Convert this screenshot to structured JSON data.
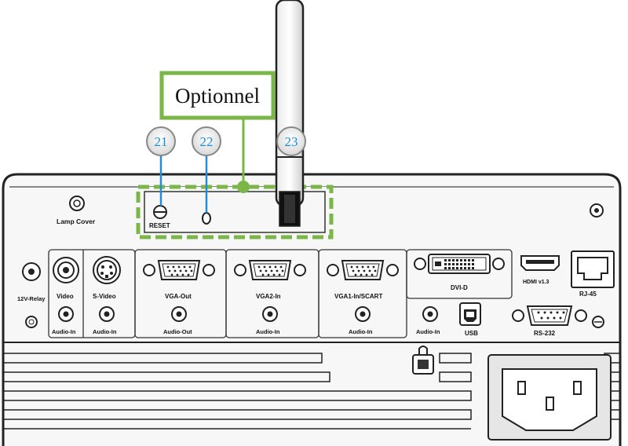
{
  "callout": {
    "title": "Optionnel",
    "accent_color": "#7ab648"
  },
  "markers": [
    {
      "num": "21"
    },
    {
      "num": "22"
    },
    {
      "num": "23"
    }
  ],
  "panel": {
    "reset": "RESET",
    "lamp_cover": "Lamp Cover",
    "relay": "12V-Relay",
    "video": "Video",
    "svideo": "S-Video",
    "vga_out": "VGA-Out",
    "vga2_in": "VGA2-In",
    "vga1_in": "VGA1-In/SCART",
    "dvi": "DVI-D",
    "hdmi": "HDMI v1.3",
    "rj45": "RJ-45",
    "audio_in_1": "Audio-In",
    "audio_in_2": "Audio-In",
    "audio_out": "Audio-Out",
    "audio_in_3": "Audio-In",
    "audio_in_4": "Audio-In",
    "audio_in_5": "Audio-In",
    "usb": "USB",
    "rs232": "RS-232"
  }
}
